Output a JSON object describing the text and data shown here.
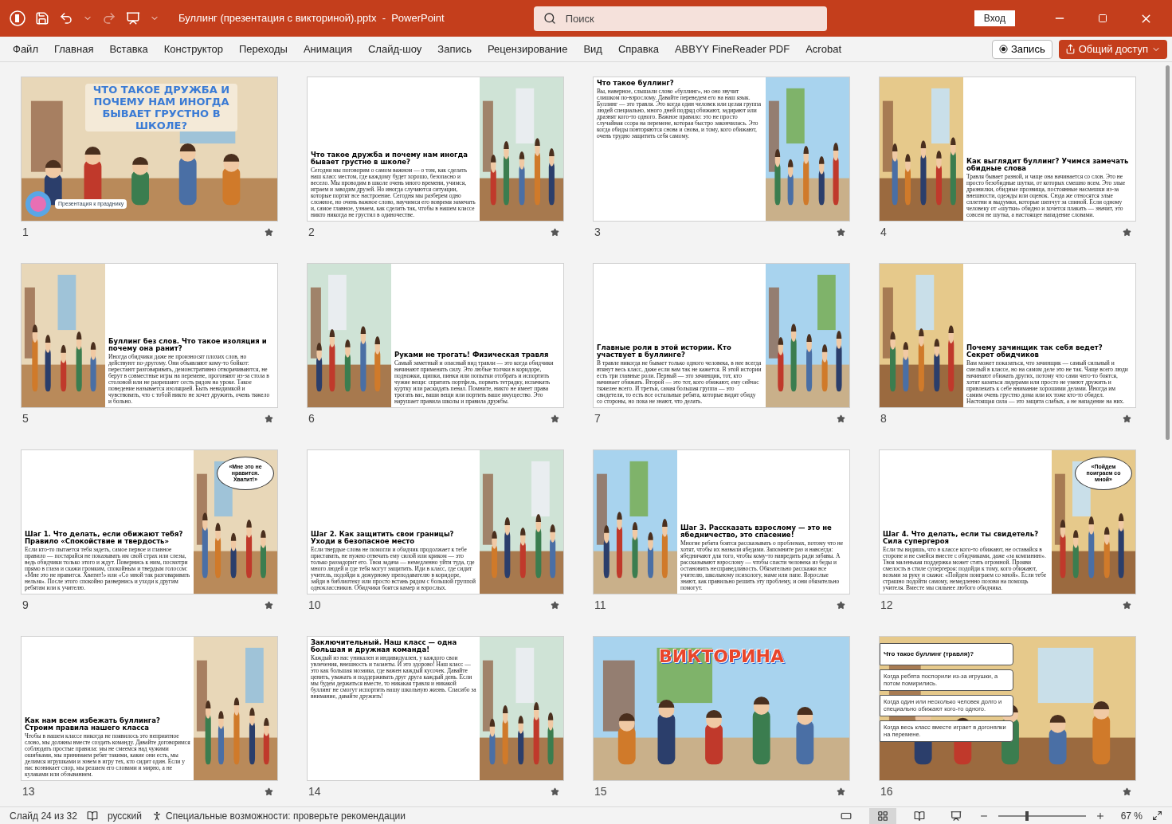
{
  "window": {
    "title": "Буллинг (презентация с викториной).pptx  -  PowerPoint",
    "search": {
      "placeholder": "Поиск"
    },
    "sign_in": "Вход"
  },
  "menu": {
    "tabs": [
      "Файл",
      "Главная",
      "Вставка",
      "Конструктор",
      "Переходы",
      "Анимация",
      "Слайд-шоу",
      "Запись",
      "Рецензирование",
      "Вид",
      "Справка",
      "ABBYY FineReader PDF",
      "Acrobat"
    ],
    "record": "Запись",
    "share": "Общий доступ"
  },
  "slides": [
    {
      "number": "1",
      "kind": "cover",
      "title": "ЧТО ТАКОЕ ДРУЖБА И ПОЧЕМУ НАМ ИНОГДА БЫВАЕТ ГРУСТНО В ШКОЛЕ?",
      "caption": "Презентация к празднику"
    },
    {
      "number": "2",
      "kind": "left",
      "title": "Что такое дружба и почему нам иногда бывает грустно в школе?",
      "body": "Сегодня мы поговорим о самом важном — о том, как сделать наш класс местом, где каждому будет хорошо, безопасно и весело. Мы проводим в школе очень много времени, учимся, играем и заводим друзей. Но иногда случаются ситуации, которые портят все настроение. Сегодня мы разберем одно сложное, но очень важное слово, научимся его вовремя замечать и, самое главное, узнаем, как сделать так, чтобы в нашем классе никто никогда не грустил в одиночестве."
    },
    {
      "number": "3",
      "kind": "top",
      "title": "Что такое буллинг?",
      "body": "Вы, наверное, слышали слово «буллинг», но оно звучит слишком по-взрослому. Давайте переведем его на наш язык. Буллинг — это травля. Это когда один человек или целая группа людей специально, много дней подряд обижают, задирают или дразнят кого-то одного. Важное правило: это не просто случайная ссора на перемене, которая быстро закончилась. Это когда обиды повторяются снова и снова, и тому, кого обижают, очень трудно защитить себя самому."
    },
    {
      "number": "4",
      "kind": "right",
      "title": "Как выглядит буллинг? Учимся замечать обидные слова",
      "body": "Травля бывает разной, и чаще она начинается со слов. Это не просто безобидные шутки, от которых смешно всем. Это злые дразнилки, обидные прозвища, постоянные насмешки из-за внешности, одежды или оценок. Сюда же относятся злые сплетни и выдумки, которые шепчут за спиной. Если одному человеку от «шутки» обидно и хочется плакать — значит, это совсем не шутка, а настоящее нападение словами."
    },
    {
      "number": "5",
      "kind": "right",
      "title": "Буллинг без слов. Что такое изоляция и почему она ранит?",
      "body": "Иногда обидчики даже не произносят плохих слов, но действуют по-другому. Они объявляют кому-то бойкот: перестают разговаривать, демонстративно отворачиваются, не берут в совместные игры на перемене, прогоняют из-за стола в столовой или не разрешают сесть рядом на уроке. Такое поведение называется изоляцией. Быть невидимкой и чувствовать, что с тобой никто не хочет дружить, очень тяжело и больно."
    },
    {
      "number": "6",
      "kind": "right",
      "title": "Руками не трогать! Физическая травля",
      "body": "Самый заметный и опасный вид травли — это когда обидчики начинают применять силу. Это любые толчки в коридоре, подножки, щипки, пинки или попытки отобрать и испортить чужие вещи: спрятать портфель, порвать тетрадку, испачкать куртку или раскидать пенал. Помните, никто не имеет права трогать вас, ваши вещи или портить ваше имущество. Это нарушает правила школы и правила дружбы."
    },
    {
      "number": "7",
      "kind": "left",
      "title": "Главные роли в этой истории. Кто участвует в буллинге?",
      "body": "В травле никогда не бывает только одного человека, в нее всегда втянут весь класс, даже если вам так не кажется. В этой истории есть три главные роли. Первый — это зачинщик, тот, кто начинает обижать. Второй — это тот, кого обижают, ему сейчас тяжелее всего. И третьи, самая большая группа — это свидетели, то есть все остальные ребята, которые видят обиду со стороны, но пока не знают, что делать."
    },
    {
      "number": "8",
      "kind": "right",
      "title": "Почему зачинщик так себя ведет? Секрет обидчиков",
      "body": "Вам может показаться, что зачинщик — самый сильный и смелый в классе, но на самом деле это не так. Чаще всего люди начинают обижать других, потому что сами чего-то боятся, хотят казаться лидерами или просто не умеют дружить и привлекать к себе внимание хорошими делами. Иногда им самим очень грустно дома или их тоже кто-то обидел. Настоящая сила — это защита слабых, а не нападение на них."
    },
    {
      "number": "9",
      "kind": "left",
      "title": "Шаг 1. Что делать, если обижают тебя? Правило «Спокойствие и твердость»",
      "body": "Если кто-то пытается тебя задеть, самое первое и главное правило — постарайся не показывать им свой страх или слезы, ведь обидчики только этого и ждут. Повернись к ним, посмотри прямо в глаза и скажи громким, спокойным и твердым голосом: «Мне это не нравится. Хватит!» или «Со мной так разговаривать нельзя». После этого спокойно развернись и уходи к другим ребятам или к учителю.",
      "bubble": "«Мне это не нравится. Хватит!»"
    },
    {
      "number": "10",
      "kind": "left",
      "title": "Шаг 2. Как защитить свои границы? Уходи в безопасное место",
      "body": "Если твердые слова не помогли и обидчик продолжает к тебе приставать, не нужно отвечать ему силой или криком — это только раззадорит его. Твоя задача — немедленно уйти туда, где много людей и где тебя могут защитить. Иди в класс, где сидит учитель, подойди к дежурному преподавателю в коридоре, зайди в библиотеку или просто встань рядом с большой группой одноклассников. Обидчики боятся камер и взрослых."
    },
    {
      "number": "11",
      "kind": "right",
      "title": "Шаг 3. Рассказать взрослому — это не ябедничество, это спасение!",
      "body": "Многие ребята боятся рассказывать о проблемах, потому что не хотят, чтобы их назвали ябедами. Запомните раз и навсегда: ябедничают для того, чтобы кому-то навредить ради забавы. А рассказывают взрослому — чтобы спасти человека из беды и остановить несправедливость. Обязательно расскажи все учителю, школьному психологу, маме или папе. Взрослые знают, как правильно решить эту проблему, и они обязательно помогут."
    },
    {
      "number": "12",
      "kind": "left",
      "title": "Шаг 4. Что делать, если ты свидетель? Сила супергероя",
      "body": "Если ты видишь, что в классе кого-то обижают, не оставайся в стороне и не смейся вместе с обидчиками, даже «за компанию». Твоя маленькая поддержка может стать огромной. Прояви смелость в стиле супергероя: подойди к тому, кого обижают, возьми за руку и скажи: «Пойдем поиграем со мной». Если тебе страшно подойти самому, немедленно позови на помощь учителя. Вместе мы сильнее любого обидчика.",
      "bubble": "«Пойдем поиграем со мной»"
    },
    {
      "number": "13",
      "kind": "left",
      "title": "Как нам всем избежать буллинга? Строим правила нашего класса",
      "body": "Чтобы в нашем классе никогда не появилось это неприятное слово, мы должны вместе создать команду. Давайте договоримся соблюдать простые правила: мы не смеемся над чужими ошибками, мы принимаем ребят такими, какие они есть, мы делимся игрушками и зовем в игру тех, кто сидит один. Если у нас возникает спор, мы решаем его словами и мирно, а не кулаками или обзыванием."
    },
    {
      "number": "14",
      "kind": "top",
      "title": "Заключительный. Наш класс — одна большая и дружная команда!",
      "body": "Каждый из нас уникален и индивидуален, у каждого свои увлечения, внешность и таланты. И это здорово! Наш класс — это как большая мозаика, где важен каждый кусочек. Давайте ценить, уважать и поддерживать друг друга каждый день. Если мы будем держаться вместе, то никакая травля и никакой буллинг не смогут испортить нашу школьную жизнь. Спасибо за внимание, давайте дружить!"
    },
    {
      "number": "15",
      "kind": "title",
      "title": "ВИКТОРИНА"
    },
    {
      "number": "16",
      "kind": "quiz",
      "title": "Что такое буллинг (травля)?",
      "answers": [
        "Когда ребята поспорили из-за игрушки, а потом помирились.",
        "Когда один или несколько человек долго и специально обижают кого-то одного.",
        "Когда весь класс вместе играет в догонялки на перемене."
      ]
    }
  ],
  "status_bar": {
    "slide": "Слайд 24 из 32",
    "language": "русский",
    "accessibility": "Специальные возможности: проверьте рекомендации",
    "views": [
      {
        "selected": false
      },
      {
        "selected": true
      },
      {
        "selected": false
      },
      {
        "selected": false
      }
    ],
    "zoom": {
      "level": 0.33,
      "reading": "67 %"
    }
  }
}
